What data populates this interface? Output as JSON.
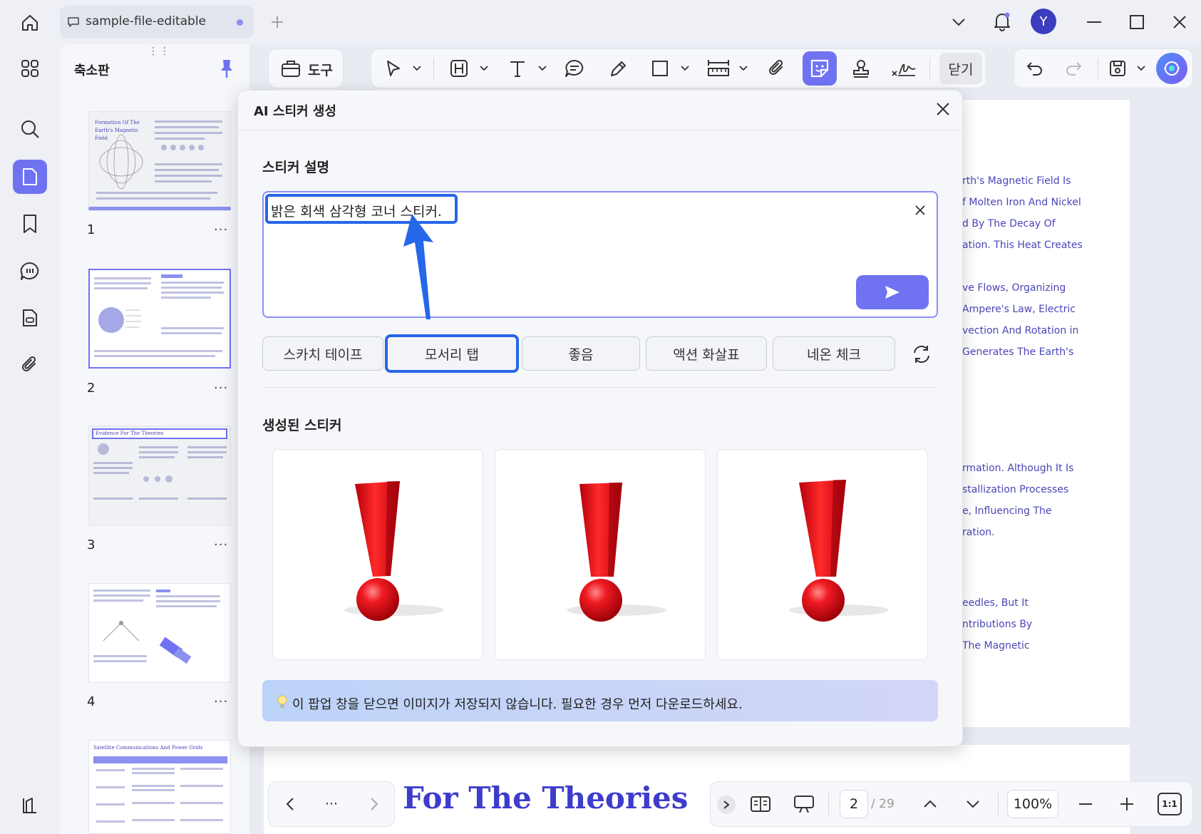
{
  "window": {
    "tab_label": "sample-file-editable",
    "avatar_letter": "Y"
  },
  "thumbnails": {
    "panel_title": "축소판",
    "pages": [
      {
        "number": "1",
        "title": "Formation Of The Earth's Magnetic Field"
      },
      {
        "number": "2"
      },
      {
        "number": "3",
        "title": "Evidence For The Theories"
      },
      {
        "number": "4"
      },
      {
        "title": "Satellite Communications And Power Grids"
      }
    ],
    "more_label": "···"
  },
  "toolbar": {
    "tools_label": "도구",
    "close_label": "닫기"
  },
  "document": {
    "lines_top": [
      "rth's Magnetic Field Is",
      "f Molten Iron And Nickel",
      "d By The Decay Of",
      "ation. This Heat Creates",
      "ve Flows, Organizing",
      " Ampere's Law, Electric",
      "vection And Rotation in",
      " Generates The Earth's"
    ],
    "lines_mid": [
      "rmation. Although It Is",
      "stallization Processes",
      "e, Influencing The",
      "ration."
    ],
    "lines_bottom": [
      "eedles, But It",
      "ntributions By",
      "The Magnetic"
    ],
    "heading": "For The Theories"
  },
  "dialog": {
    "title": "AI 스티커 생성",
    "desc_section": "스티커 설명",
    "desc_value": "밝은 회색 삼각형 코너 스티커.",
    "chips": [
      "스카치 테이프",
      "모서리 탭",
      "좋음",
      "액션 화살표",
      "네온 체크"
    ],
    "selected_chip": "모서리 탭",
    "generated_section": "생성된 스티커",
    "notice": "이 팝업 창을 닫으면 이미지가 저장되지 않습니다. 필요한 경우 먼저 다운로드하세요."
  },
  "bottom_bar": {
    "current_page": "2",
    "total_pages": "/ 29",
    "zoom": "100%",
    "actual_size_label": "1:1",
    "more_label": "···"
  },
  "colors": {
    "accent": "#6f73f2",
    "highlight": "#2666e8",
    "sticker_red": "#e8141c",
    "doc_text": "#4a46b8"
  }
}
